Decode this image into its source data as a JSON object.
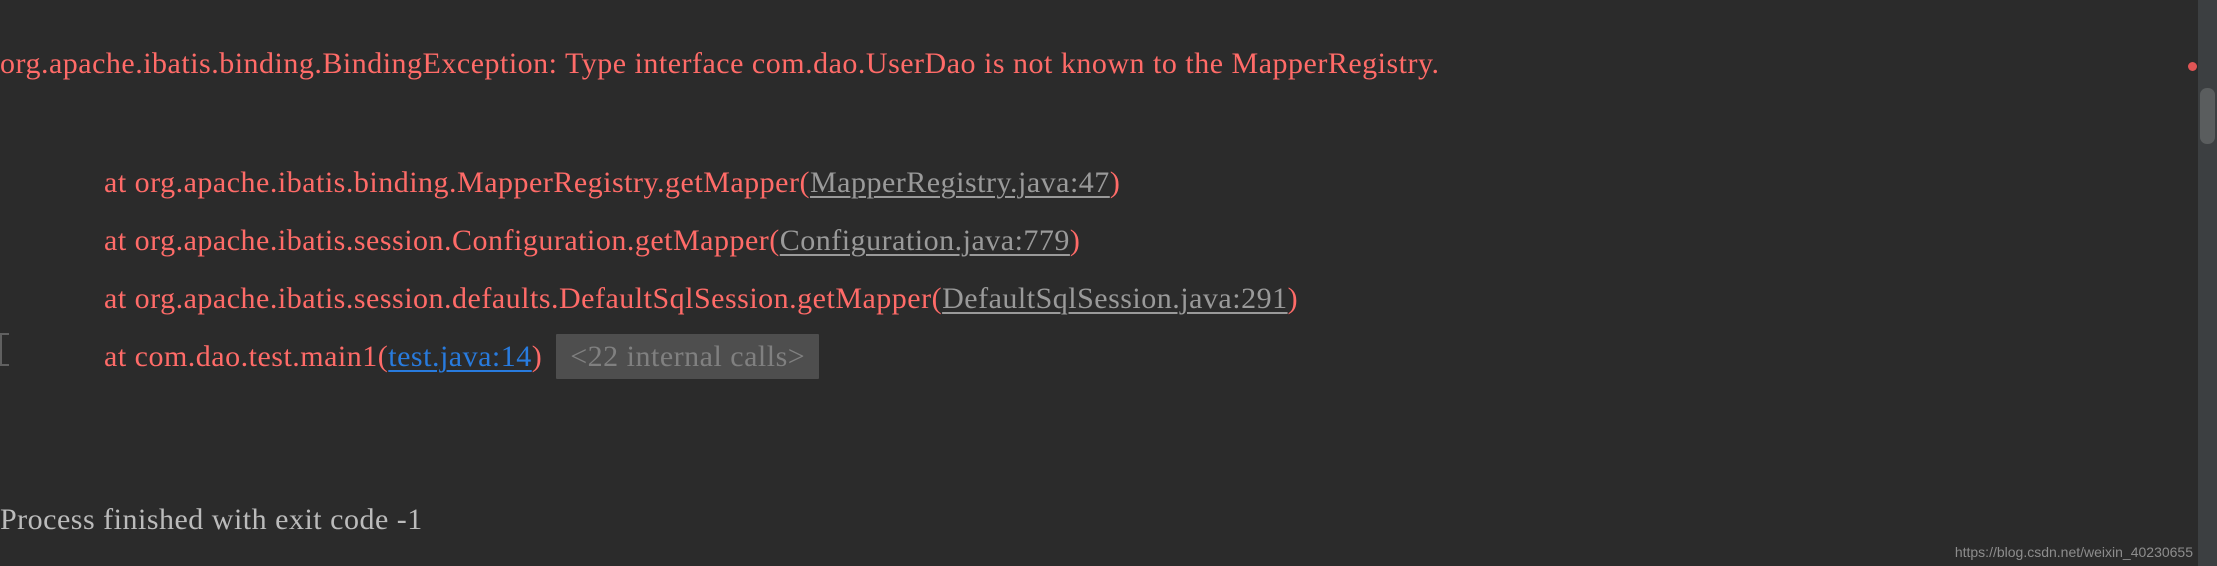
{
  "console": {
    "theme_background": "#2b2b2b",
    "error_color": "#ff6b68",
    "link_color": "#287bde",
    "file_link_color": "#9a9a9a",
    "exit_text_color": "#bbbbbb",
    "highlight_background": "#4e4e4e"
  },
  "exception": {
    "message": "org.apache.ibatis.binding.BindingException: Type interface com.dao.UserDao is not known to the MapperRegistry."
  },
  "stack_trace": [
    {
      "at": "    at ",
      "frame": "org.apache.ibatis.binding.MapperRegistry.getMapper",
      "open_paren": "(",
      "file": "MapperRegistry.java:47",
      "close_paren": ")",
      "link_style": "gray"
    },
    {
      "at": "    at ",
      "frame": "org.apache.ibatis.session.Configuration.getMapper",
      "open_paren": "(",
      "file": "Configuration.java:779",
      "close_paren": ")",
      "link_style": "gray"
    },
    {
      "at": "    at ",
      "frame": "org.apache.ibatis.session.defaults.DefaultSqlSession.getMapper",
      "open_paren": "(",
      "file": "DefaultSqlSession.java:291",
      "close_paren": ")",
      "link_style": "gray"
    },
    {
      "at": "    at ",
      "frame": "com.dao.test.main1",
      "open_paren": "(",
      "file": "test.java:14",
      "close_paren": ")",
      "link_style": "blue",
      "internal_calls": "<22 internal calls>"
    }
  ],
  "exit": {
    "text": "Process finished with exit code -1"
  },
  "watermark": {
    "text": "https://blog.csdn.net/weixin_40230655"
  }
}
